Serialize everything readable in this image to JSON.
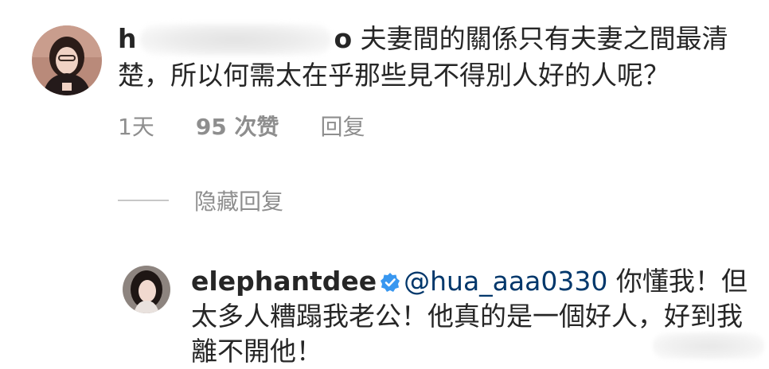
{
  "main_comment": {
    "username_visible": "h",
    "username_tail": "o",
    "text": " 夫妻間的關係只有夫妻之間最清楚，所以何需太在乎那些見不得別人好的人呢？",
    "time": "1天",
    "likes": "95 次赞",
    "reply_label": "回复"
  },
  "hidden_replies": {
    "label": "隐藏回复"
  },
  "reply": {
    "username": "elephantdee",
    "mention": "@hua_aaa0330",
    "text": " 你懂我！但太多人糟蹋我老公！他真的是一個好人，好到我離不開他！"
  },
  "colors": {
    "text": "#262626",
    "meta": "#8e8e8e",
    "verified": "#3897f0",
    "mention": "#00376b"
  },
  "icons": {
    "verified": "verified-badge-icon"
  }
}
